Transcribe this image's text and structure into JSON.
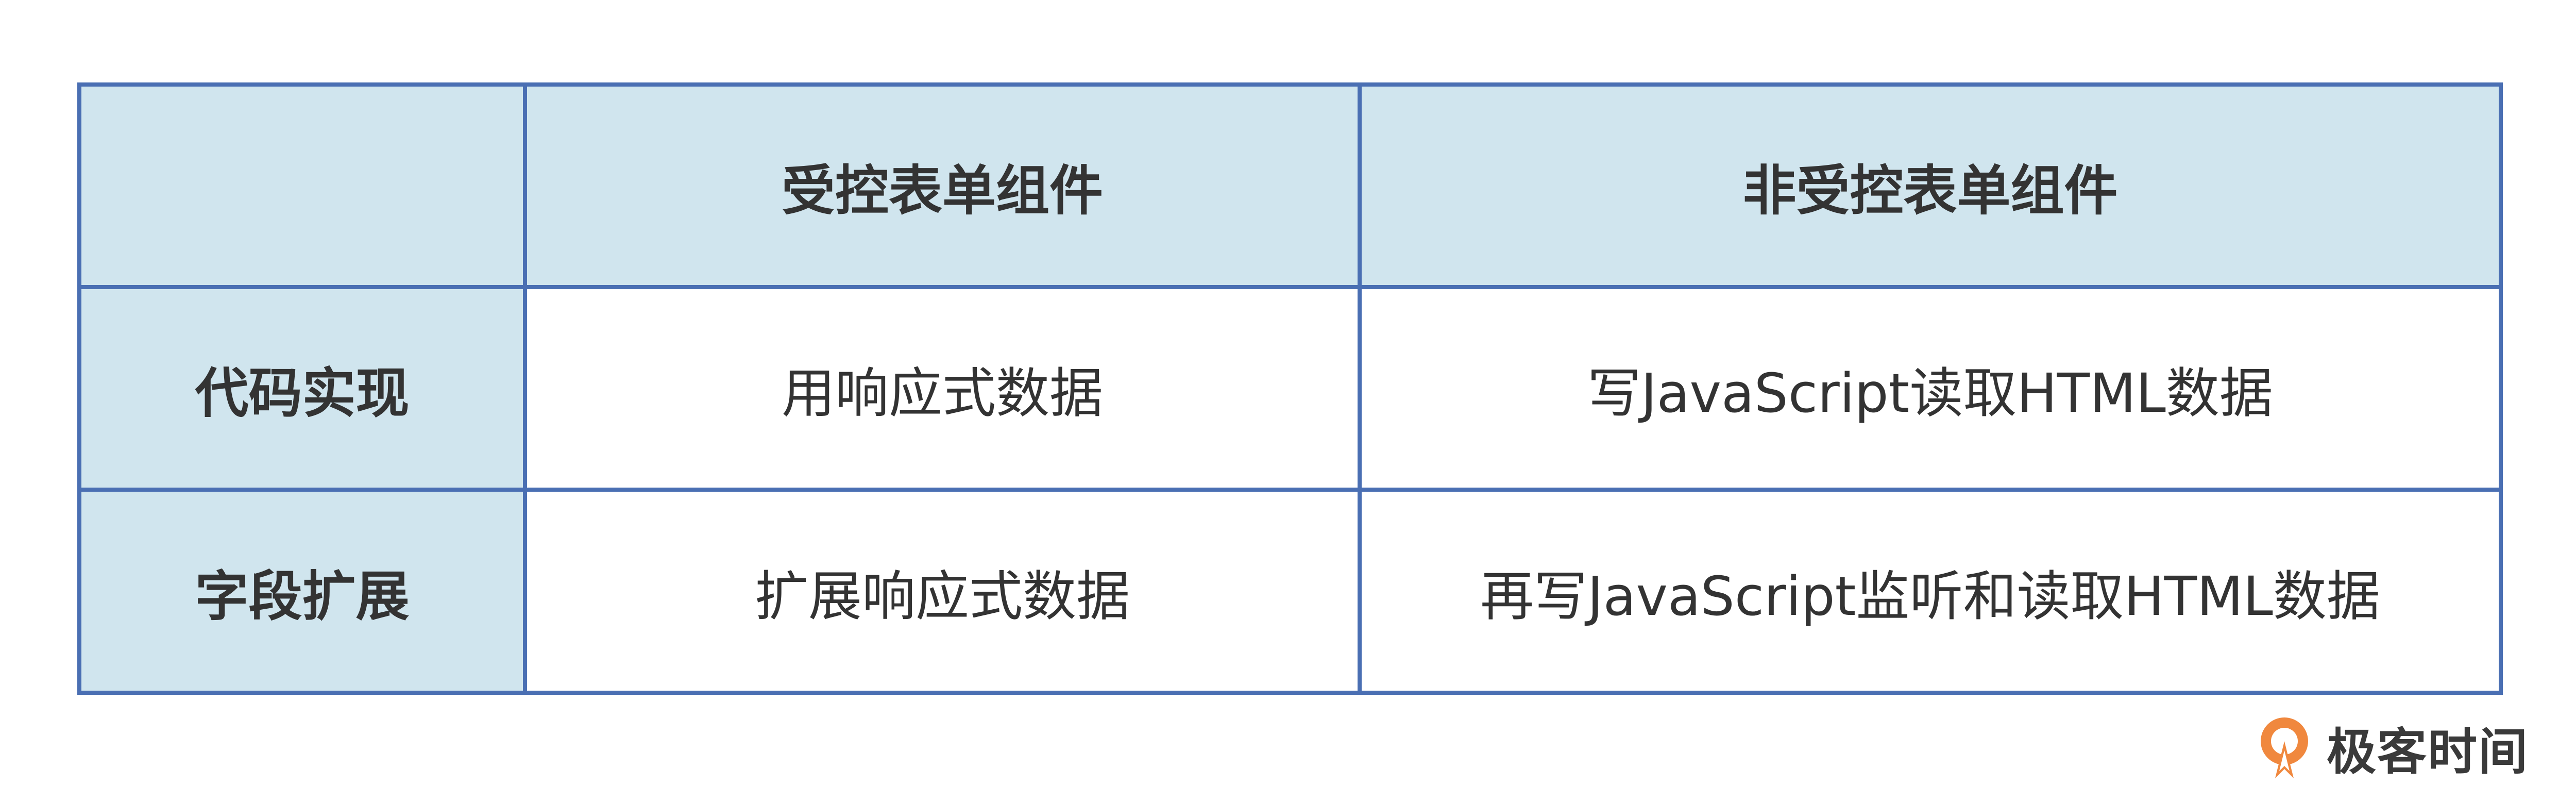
{
  "table": {
    "header": {
      "corner": "",
      "col1": "受控表单组件",
      "col2": "非受控表单组件"
    },
    "rows": [
      {
        "label": "代码实现",
        "controlled": "用响应式数据",
        "uncontrolled": "写JavaScript读取HTML数据"
      },
      {
        "label": "字段扩展",
        "controlled": "扩展响应式数据",
        "uncontrolled": "再写JavaScript监听和读取HTML数据"
      }
    ]
  },
  "brand": {
    "name": "极客时间",
    "icon": "geektime-logo-icon",
    "color": "#f0883e"
  },
  "colors": {
    "border": "#4a6fb3",
    "header_bg": "#d0e5ee",
    "text": "#333333"
  }
}
